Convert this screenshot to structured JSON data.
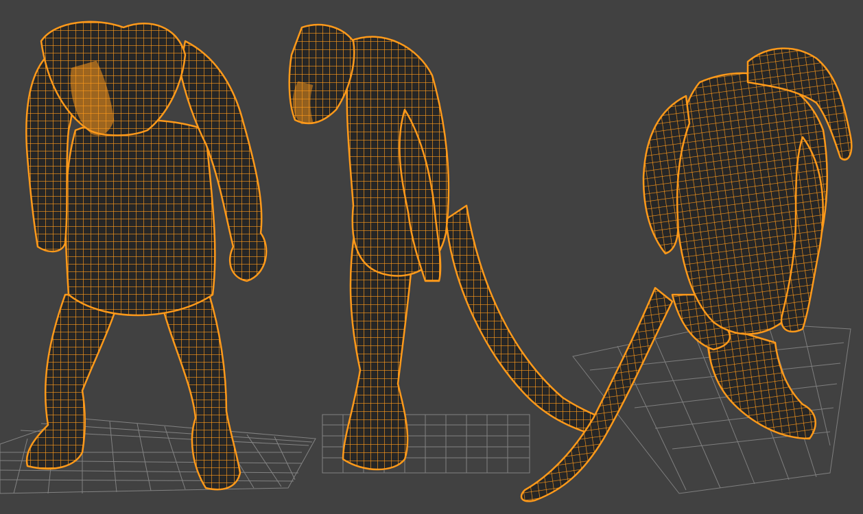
{
  "scene": {
    "background_color": "#414141",
    "wire_color": "#ff9a1a",
    "mesh_fill_color": "#262626",
    "grid_color": "#9a9a9a"
  },
  "viewports": [
    {
      "view": "front",
      "mesh": "creature-mesh",
      "grid": true
    },
    {
      "view": "side",
      "mesh": "creature-mesh",
      "grid": true
    },
    {
      "view": "rear-perspective",
      "mesh": "creature-mesh",
      "grid": true
    }
  ]
}
